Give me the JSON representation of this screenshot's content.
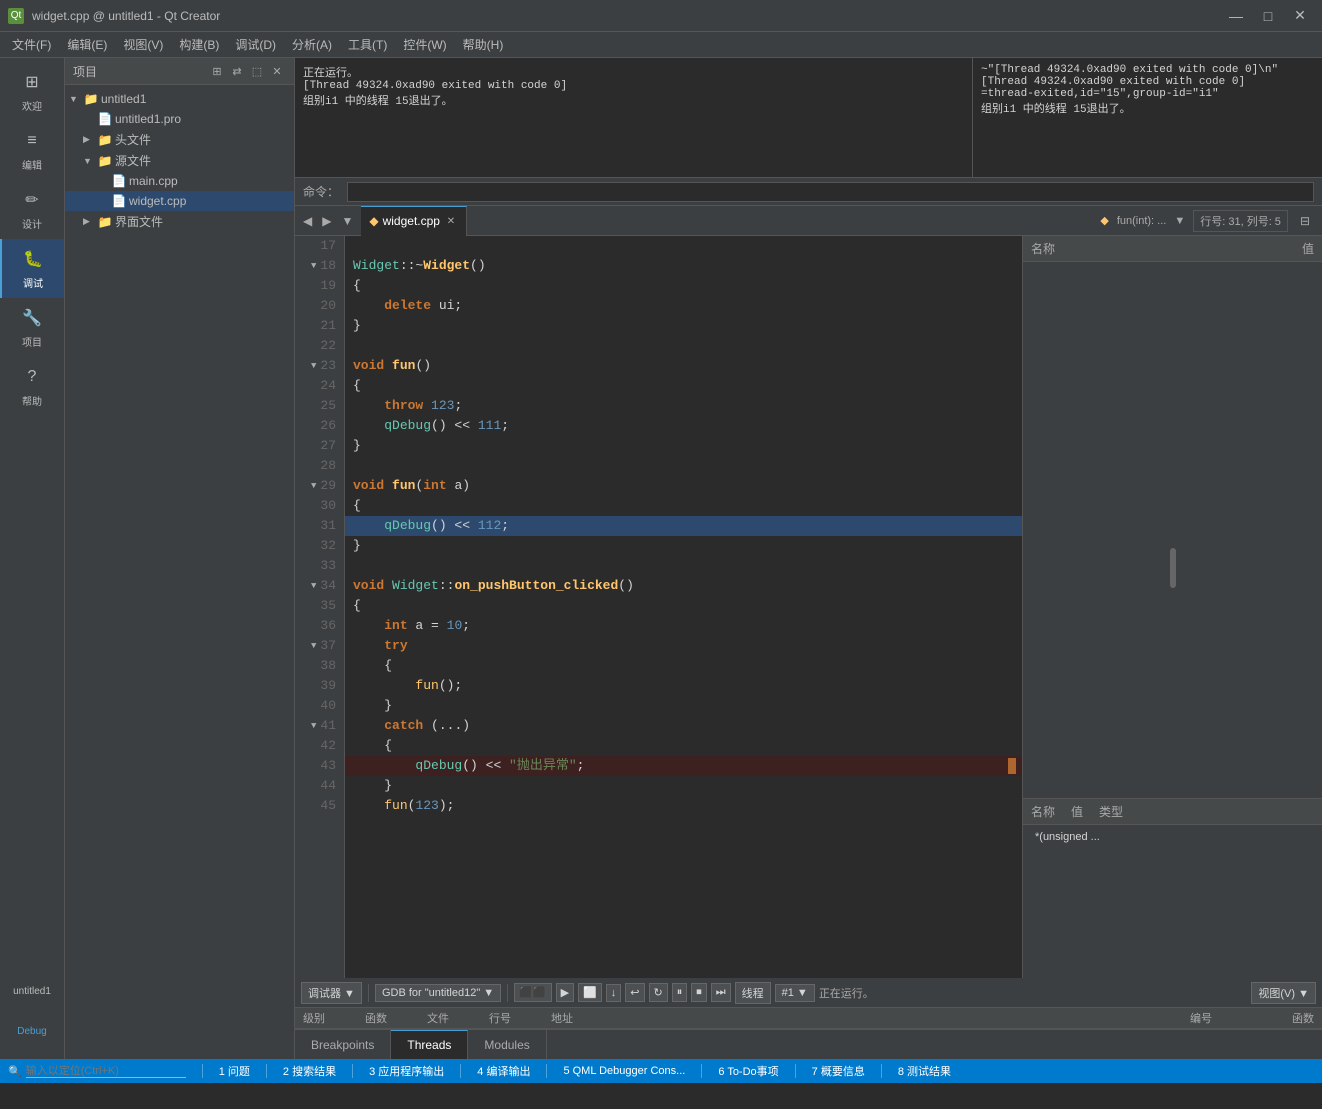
{
  "titleBar": {
    "title": "widget.cpp @ untitled1 - Qt Creator",
    "icon": "Qt",
    "minimize": "—",
    "maximize": "□",
    "close": "✕"
  },
  "menuBar": {
    "items": [
      "文件(F)",
      "编辑(E)",
      "视图(V)",
      "构建(B)",
      "调试(D)",
      "分析(A)",
      "工具(T)",
      "控件(W)",
      "帮助(H)"
    ]
  },
  "leftSidebar": {
    "items": [
      {
        "id": "welcome",
        "label": "欢迎",
        "icon": "⊞"
      },
      {
        "id": "edit",
        "label": "编辑",
        "icon": "≡"
      },
      {
        "id": "design",
        "label": "设计",
        "icon": "✏"
      },
      {
        "id": "debug",
        "label": "调试",
        "icon": "⬛",
        "active": true
      },
      {
        "id": "projects",
        "label": "项目",
        "icon": "🔧"
      },
      {
        "id": "help",
        "label": "帮助",
        "icon": "?"
      }
    ],
    "bottomItems": [
      {
        "id": "untitled1",
        "label": "untitled1"
      },
      {
        "id": "debug-mode",
        "label": "Debug"
      }
    ]
  },
  "projectPanel": {
    "header": "项目",
    "tree": [
      {
        "level": 0,
        "type": "folder",
        "label": "untitled1",
        "expanded": true,
        "arrow": "▼"
      },
      {
        "level": 1,
        "type": "file",
        "label": "untitled1.pro"
      },
      {
        "level": 1,
        "type": "folder",
        "label": "头文件",
        "expanded": false,
        "arrow": "▶"
      },
      {
        "level": 1,
        "type": "folder",
        "label": "源文件",
        "expanded": true,
        "arrow": "▼"
      },
      {
        "level": 2,
        "type": "file",
        "label": "main.cpp"
      },
      {
        "level": 2,
        "type": "file",
        "label": "widget.cpp",
        "selected": true
      },
      {
        "level": 1,
        "type": "folder",
        "label": "界面文件",
        "expanded": false,
        "arrow": "▶"
      }
    ]
  },
  "outputArea": {
    "left": {
      "lines": [
        "正在运行。",
        "[Thread 49324.0xad90 exited with code 0]",
        "组别i1 中的线程 15退出了。"
      ]
    },
    "right": {
      "lines": [
        "~\"[Thread 49324.0xad90 exited with code 0]\\n\"",
        "[Thread 49324.0xad90 exited with code 0]",
        "=thread-exited,id=\"15\",group-id=\"i1\"",
        "组别i1 中的线程 15退出了。"
      ]
    },
    "commandLabel": "命令：",
    "commandPlaceholder": ""
  },
  "editor": {
    "activeTab": "widget.cpp",
    "tabIcon": "◆",
    "breadcrumb": "fun(int): ...",
    "position": "行号: 31, 列号: 5",
    "nameLabel": "名称",
    "valueLabel": "值"
  },
  "codeLines": [
    {
      "num": 17,
      "content": "",
      "hasArrow": false
    },
    {
      "num": 18,
      "content": "Widget::~Widget()",
      "hasArrow": true
    },
    {
      "num": 19,
      "content": "{",
      "hasArrow": false
    },
    {
      "num": 20,
      "content": "    delete ui;",
      "hasArrow": false
    },
    {
      "num": 21,
      "content": "}",
      "hasArrow": false
    },
    {
      "num": 22,
      "content": "",
      "hasArrow": false
    },
    {
      "num": 23,
      "content": "void fun()",
      "hasArrow": true
    },
    {
      "num": 24,
      "content": "{",
      "hasArrow": false
    },
    {
      "num": 25,
      "content": "    throw 123;",
      "hasArrow": false
    },
    {
      "num": 26,
      "content": "    qDebug() << 111;",
      "hasArrow": false
    },
    {
      "num": 27,
      "content": "}",
      "hasArrow": false
    },
    {
      "num": 28,
      "content": "",
      "hasArrow": false
    },
    {
      "num": 29,
      "content": "void fun(int a)",
      "hasArrow": true
    },
    {
      "num": 30,
      "content": "{",
      "hasArrow": false
    },
    {
      "num": 31,
      "content": "    qDebug() << 112;",
      "hasArrow": false,
      "highlighted": true
    },
    {
      "num": 32,
      "content": "}",
      "hasArrow": false
    },
    {
      "num": 33,
      "content": "",
      "hasArrow": false
    },
    {
      "num": 34,
      "content": "void Widget::on_pushButton_clicked()",
      "hasArrow": true
    },
    {
      "num": 35,
      "content": "{",
      "hasArrow": false
    },
    {
      "num": 36,
      "content": "    int a = 10;",
      "hasArrow": false
    },
    {
      "num": 37,
      "content": "    try",
      "hasArrow": true
    },
    {
      "num": 38,
      "content": "    {",
      "hasArrow": false
    },
    {
      "num": 39,
      "content": "        fun();",
      "hasArrow": false
    },
    {
      "num": 40,
      "content": "    }",
      "hasArrow": false
    },
    {
      "num": 41,
      "content": "    catch (...)",
      "hasArrow": true
    },
    {
      "num": 42,
      "content": "    {",
      "hasArrow": false
    },
    {
      "num": 43,
      "content": "        qDebug() << \"抛出异常\";",
      "hasArrow": false,
      "hasBreakpoint": true
    },
    {
      "num": 44,
      "content": "    }",
      "hasArrow": false
    },
    {
      "num": 45,
      "content": "    fun(123);",
      "hasArrow": false
    }
  ],
  "rightPanel": {
    "nameHeader": "名称",
    "valueHeader": "值",
    "bottomHeaders": [
      "名称",
      "值",
      "类型"
    ],
    "bottomRows": [
      {
        "name": "*(unsigned ...",
        "value": "",
        "type": ""
      }
    ]
  },
  "debugToolbar": {
    "items": [
      "调试器 ▼",
      "GDB for \"untitled12\" ▼"
    ],
    "icons": [
      "⬛⬛",
      "▶▶",
      "⬜",
      "↓",
      "↩",
      "↻",
      "⏸",
      "⏹",
      "⏭"
    ],
    "thread": "#1",
    "rightLabel": "正在运行。",
    "viewLabel": "视图(V) ▼"
  },
  "stackFrame": {
    "headers": [
      "级别",
      "函数",
      "文件",
      "行号",
      "地址",
      "编号",
      "函数"
    ],
    "rows": []
  },
  "bottomTabs": {
    "tabs": [
      "Breakpoints",
      "Threads",
      "Modules"
    ],
    "activeTab": "Threads"
  },
  "statusBar": {
    "items": [
      "1 问题",
      "2 搜索结果",
      "3 应用程序输出",
      "4 编译输出",
      "5 QML Debugger Cons...",
      "6 To-Do事项",
      "7 概要信息",
      "8 测试结果"
    ]
  }
}
